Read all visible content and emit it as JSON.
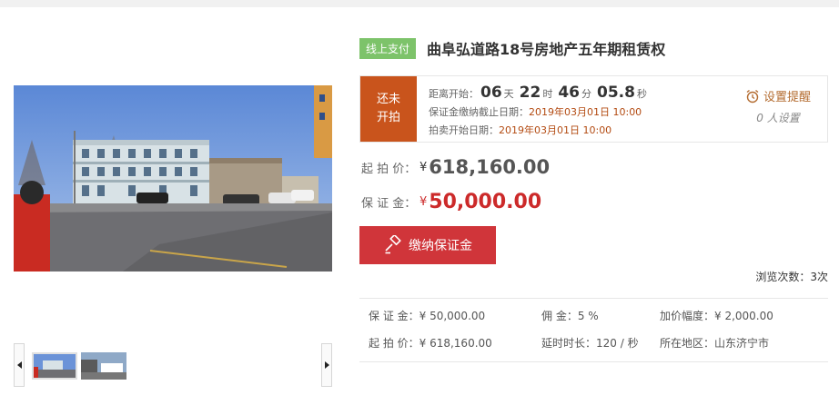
{
  "auction": {
    "badge": "线上支付",
    "title": "曲阜弘道路18号房地产五年期租赁权"
  },
  "countdown": {
    "status_line1": "还未",
    "status_line2": "开拍",
    "start_label": "距离开始：",
    "days": "06",
    "days_unit": "天",
    "hours": "22",
    "hours_unit": "时",
    "minutes": "46",
    "minutes_unit": "分",
    "seconds": "05.8",
    "seconds_unit": "秒",
    "deposit_deadline_label": "保证金缴纳截止日期：",
    "deposit_deadline": "2019年03月01日 10:00",
    "auction_start_label": "拍卖开始日期：",
    "auction_start": "2019年03月01日 10:00"
  },
  "reminder": {
    "label": "设置提醒",
    "count": "0",
    "count_suffix": "人设置",
    "icon": "alarm-clock-icon"
  },
  "prices": {
    "start_label": "起  拍  价：",
    "start_currency": "¥",
    "start_value": "618,160.00",
    "deposit_label": "保  证  金：",
    "deposit_currency": "¥",
    "deposit_value": "50,000.00"
  },
  "pay_button": {
    "label": "缴纳保证金",
    "icon": "gavel-icon"
  },
  "views": {
    "label": "浏览次数：",
    "count": "3",
    "unit": "次"
  },
  "details": {
    "row1": {
      "deposit": "保  证  金：¥ 50,000.00",
      "commission": "佣        金：5 %",
      "increment": "加价幅度：¥ 2,000.00"
    },
    "row2": {
      "start_price": "起  拍  价：¥ 618,160.00",
      "delay": "延时时长：120 / 秒",
      "location": "所在地区：山东济宁市"
    }
  },
  "colors": {
    "status_orange": "#c9541c",
    "accent_red": "#d0353a",
    "price_red": "#cc2a2a",
    "badge_green": "#7dc36a",
    "reminder_brown": "#b36b2f"
  }
}
